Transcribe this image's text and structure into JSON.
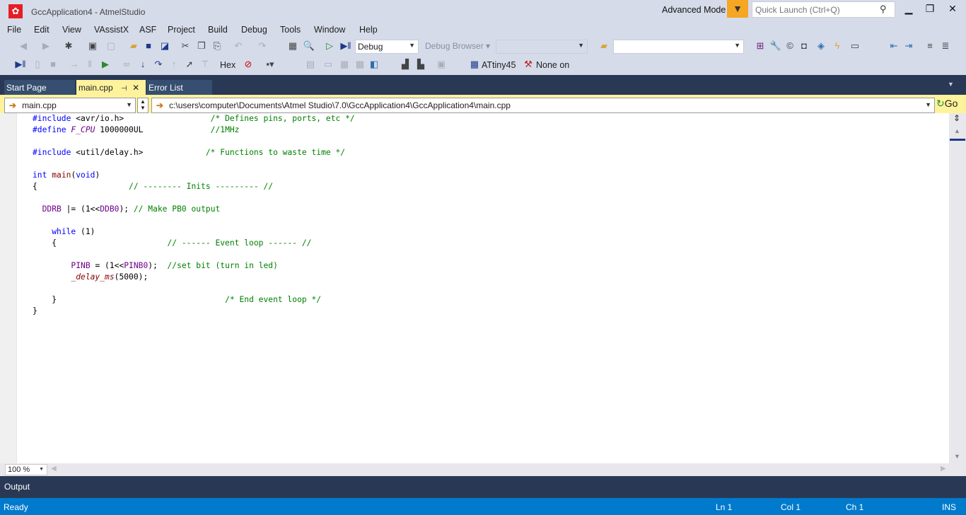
{
  "window": {
    "title": "GccApplication4 - AtmelStudio",
    "advanced_mode": "Advanced Mode",
    "quick_launch_placeholder": "Quick Launch (Ctrl+Q)",
    "logo_icon": "atmel-ladybug-icon"
  },
  "menu": [
    "File",
    "Edit",
    "View",
    "VAssistX",
    "ASF",
    "Project",
    "Build",
    "Debug",
    "Tools",
    "Window",
    "Help"
  ],
  "toolbar1": {
    "configuration": "Debug",
    "debug_browser": "Debug Browser",
    "platform": "",
    "search": ""
  },
  "toolbar2": {
    "hex": "Hex",
    "device": "ATtiny45",
    "tool": "None on"
  },
  "tabs": [
    {
      "label": "Start Page"
    },
    {
      "label": "main.cpp",
      "active": true
    },
    {
      "label": "Error List"
    }
  ],
  "nav": {
    "file": "main.cpp",
    "path": "c:\\users\\computer\\Documents\\Atmel Studio\\7.0\\GccApplication4\\GccApplication4\\main.cpp",
    "go": "Go"
  },
  "code": [
    [
      [
        "#include",
        "pp"
      ],
      [
        " <avr/io.h>                  ",
        "tx"
      ],
      [
        "/* Defines pins, ports, etc */",
        "cm"
      ]
    ],
    [
      [
        "#define ",
        "pp"
      ],
      [
        "F_CPU",
        "mac"
      ],
      [
        " 1000000UL              ",
        "tx"
      ],
      [
        "//1MHz",
        "cm"
      ]
    ],
    [],
    [
      [
        "#include",
        "pp"
      ],
      [
        " <util/delay.h>             ",
        "tx"
      ],
      [
        "/* Functions to waste time */",
        "cm"
      ]
    ],
    [],
    [
      [
        "int",
        "kw"
      ],
      [
        " ",
        "tx"
      ],
      [
        "main",
        "fn"
      ],
      [
        "(",
        "tx"
      ],
      [
        "void",
        "kw"
      ],
      [
        ")",
        "tx"
      ]
    ],
    [
      [
        "{                   ",
        "tx"
      ],
      [
        "// -------- Inits --------- //",
        "cm"
      ]
    ],
    [],
    [
      [
        "  ",
        "tx"
      ],
      [
        "DDRB",
        "reg"
      ],
      [
        " |= (1<<",
        "tx"
      ],
      [
        "DDB0",
        "reg"
      ],
      [
        "); ",
        "tx"
      ],
      [
        "// Make PB0 output",
        "cm"
      ]
    ],
    [],
    [
      [
        "    ",
        "tx"
      ],
      [
        "while",
        "kw"
      ],
      [
        " (1)",
        "tx"
      ]
    ],
    [
      [
        "    {                       ",
        "tx"
      ],
      [
        "// ------ Event loop ------ //",
        "cm"
      ]
    ],
    [],
    [
      [
        "        ",
        "tx"
      ],
      [
        "PINB",
        "reg"
      ],
      [
        " = (1<<",
        "tx"
      ],
      [
        "PINB0",
        "reg"
      ],
      [
        ");  ",
        "tx"
      ],
      [
        "//set bit (turn in led)",
        "cm"
      ]
    ],
    [
      [
        "        ",
        "tx"
      ],
      [
        "_delay_ms",
        "call"
      ],
      [
        "(5000);",
        "tx"
      ]
    ],
    [],
    [
      [
        "    }                                   ",
        "tx"
      ],
      [
        "/* End event loop */",
        "cm"
      ]
    ],
    [
      [
        "}",
        "tx"
      ]
    ]
  ],
  "editor": {
    "zoom": "100 %"
  },
  "output": {
    "label": "Output"
  },
  "status": {
    "ready": "Ready",
    "ln": "Ln 1",
    "col": "Col 1",
    "ch": "Ch 1",
    "mode": "INS"
  },
  "colors": {
    "status_bar": "#007acc",
    "tab_strip": "#293955",
    "active_tab": "#fff29d",
    "filter": "#f5a623"
  }
}
